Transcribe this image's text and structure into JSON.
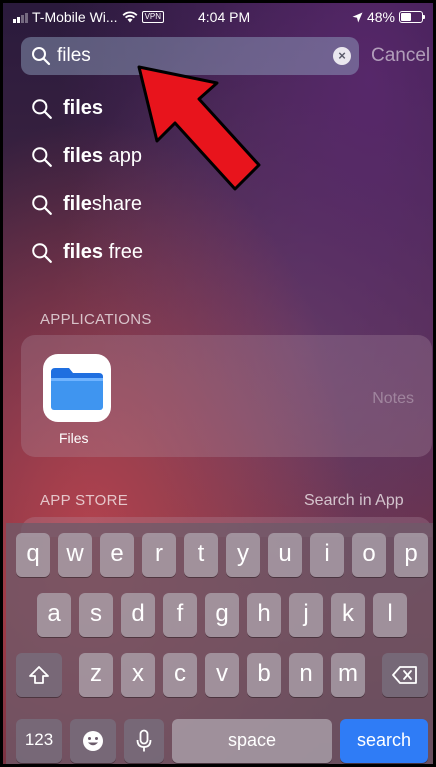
{
  "status": {
    "carrier": "T-Mobile Wi...",
    "vpn": "VPN",
    "time": "4:04 PM",
    "battery": "48%"
  },
  "search": {
    "value": "files",
    "cancel_label": "Cancel"
  },
  "suggestions": [
    {
      "typed": "files",
      "rest": ""
    },
    {
      "typed": "files",
      "rest": " app"
    },
    {
      "typed": "file",
      "rest": "share"
    },
    {
      "typed": "files",
      "rest": " free"
    }
  ],
  "applications": {
    "header": "APPLICATIONS",
    "app_name": "Files",
    "note": "Notes"
  },
  "app_store": {
    "header": "APP STORE",
    "link": "Search in App"
  },
  "keyboard": {
    "row1": [
      "q",
      "w",
      "e",
      "r",
      "t",
      "y",
      "u",
      "i",
      "o",
      "p"
    ],
    "row2": [
      "a",
      "s",
      "d",
      "f",
      "g",
      "h",
      "j",
      "k",
      "l"
    ],
    "row3": [
      "z",
      "x",
      "c",
      "v",
      "b",
      "n",
      "m"
    ],
    "numbers_label": "123",
    "space_label": "space",
    "search_label": "search"
  },
  "colors": {
    "search_key": "#2f7cf6",
    "arrow": "#e8141c"
  },
  "icons": [
    "signal-icon",
    "wifi-icon",
    "location-icon",
    "battery-icon",
    "magnifier-icon",
    "clear-icon",
    "shift-icon",
    "backspace-icon",
    "emoji-icon",
    "microphone-icon",
    "folder-icon",
    "arrow-annotation"
  ]
}
